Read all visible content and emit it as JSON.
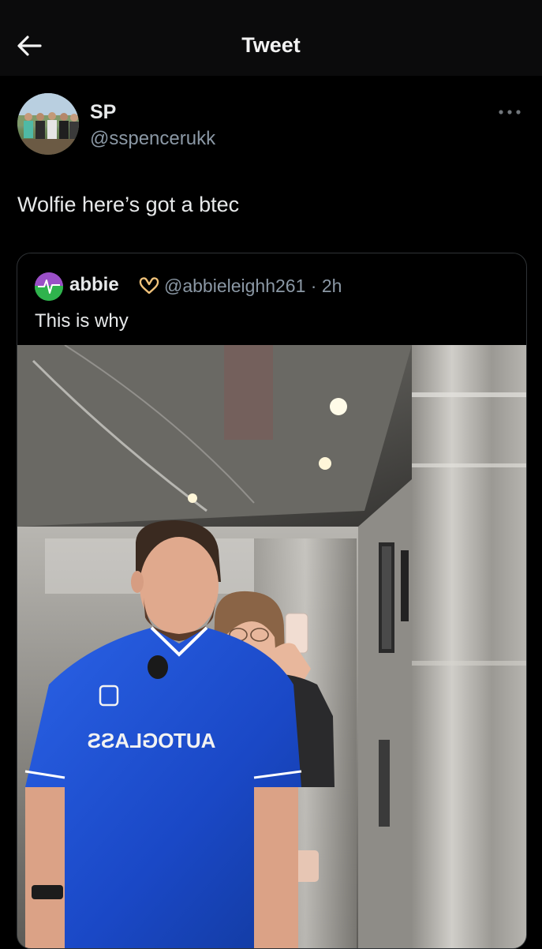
{
  "header": {
    "title": "Tweet",
    "back_icon": "arrow-left-icon"
  },
  "tweet": {
    "author_name": "SP",
    "author_handle": "@sspencerukk",
    "text": "Wolfie here’s got a btec",
    "more_icon": "more-horizontal-icon"
  },
  "quoted_tweet": {
    "author_name": "abbie",
    "badge_icon": "heart-hands-icon",
    "author_handle": "@abbieleighh261",
    "separator": "·",
    "time": "2h",
    "text": "This is why",
    "photo_shirt_text": "AUTOGLASS"
  },
  "colors": {
    "background": "#000000",
    "secondary_text": "#8b98a5",
    "shirt_blue": "#1b4fd0"
  }
}
